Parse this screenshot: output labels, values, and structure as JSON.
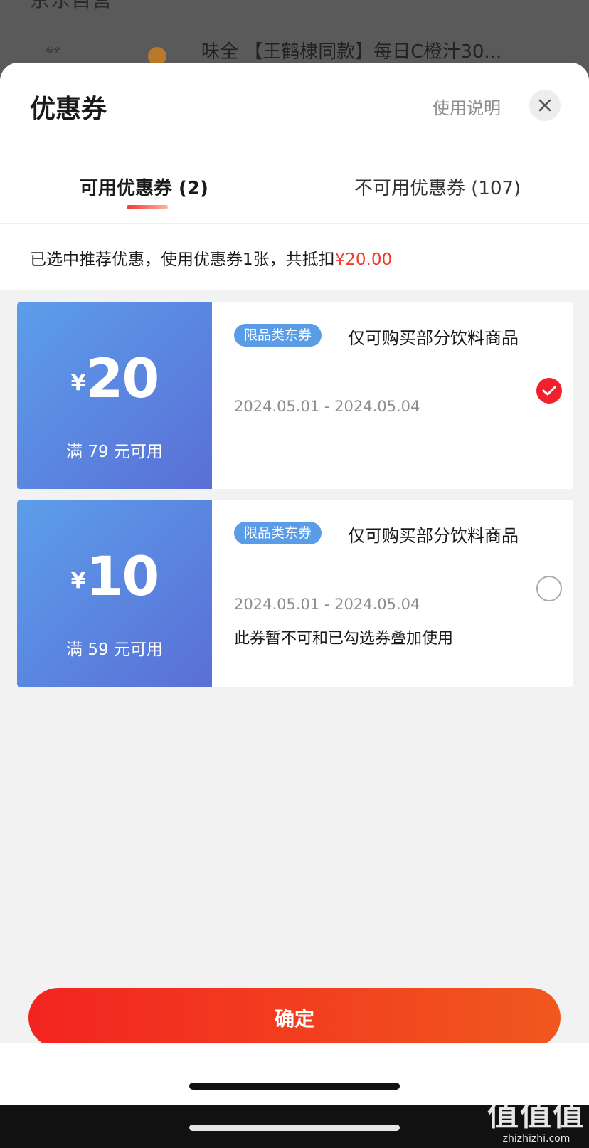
{
  "background": {
    "shop_name": "京东自营",
    "product_title": "味全 【王鹤棣同款】每日C橙汁30...",
    "product_logo": "味全"
  },
  "sheet": {
    "title": "优惠券",
    "help_link": "使用说明",
    "close_icon": "close-icon",
    "tabs": [
      {
        "label": "可用优惠券 (2)",
        "active": true
      },
      {
        "label": "不可用优惠券 (107)",
        "active": false
      }
    ],
    "summary_prefix": "已选中推荐优惠，使用优惠券1张，共抵扣",
    "summary_amount": "¥20.00"
  },
  "coupons": [
    {
      "currency": "¥",
      "amount": "20",
      "condition": "满 79 元可用",
      "badge": "限品类东券",
      "description": "仅可购买部分饮料商品",
      "date_range": "2024.05.01 - 2024.05.04",
      "note": "",
      "selected": true
    },
    {
      "currency": "¥",
      "amount": "10",
      "condition": "满 59 元可用",
      "badge": "限品类东券",
      "description": "仅可购买部分饮料商品",
      "date_range": "2024.05.01 - 2024.05.04",
      "note": "此券暂不可和已勾选券叠加使用",
      "selected": false
    }
  ],
  "confirm_label": "确定",
  "watermark": {
    "glyph": "值值值",
    "url": "zhizhizhi.com"
  },
  "colors": {
    "accent": "#f23a2a",
    "coupon_blue": "#5c9eea",
    "confirm": "#f32420"
  }
}
